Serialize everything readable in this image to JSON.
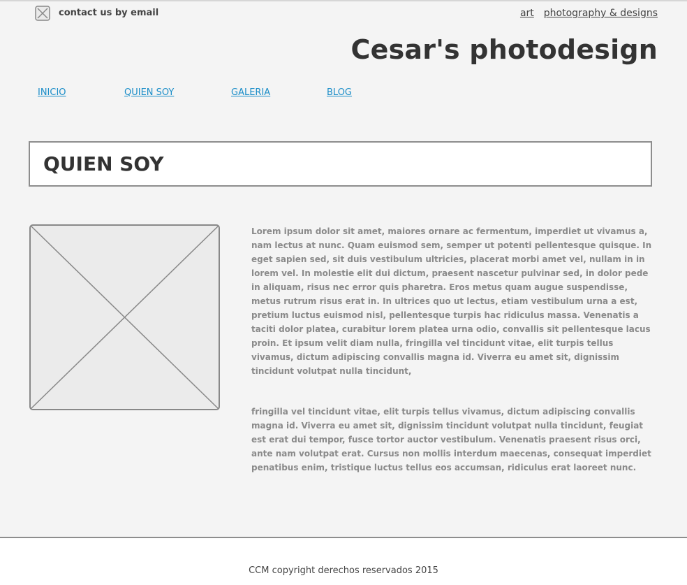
{
  "header": {
    "contact_label": "contact us by email",
    "tagline": [
      "art",
      "photography & designs"
    ],
    "site_title": "Cesar's photodesign"
  },
  "nav": {
    "items": [
      "INICIO",
      "QUIEN SOY",
      "GALERIA",
      "BLOG"
    ]
  },
  "page": {
    "heading": "QUIEN SOY",
    "paragraphs": [
      "Lorem ipsum dolor sit amet, maiores ornare ac fermentum, imperdiet ut vivamus a, nam lectus at nunc. Quam euismod sem, semper ut potenti pellentesque quisque. In eget sapien sed, sit duis vestibulum ultricies, placerat morbi amet vel, nullam in in lorem vel. In molestie elit dui dictum, praesent nascetur pulvinar sed, in dolor pede in aliquam, risus nec error quis pharetra. Eros metus quam augue suspendisse, metus rutrum risus erat in.  In ultrices quo ut lectus, etiam vestibulum urna a est, pretium luctus euismod nisl, pellentesque turpis hac ridiculus massa. Venenatis a taciti dolor platea, curabitur lorem platea urna odio, convallis sit pellentesque lacus proin. Et ipsum velit diam nulla, fringilla vel tincidunt vitae, elit turpis tellus vivamus, dictum adipiscing convallis magna id. Viverra eu amet sit, dignissim tincidunt volutpat nulla tincidunt,",
      " fringilla vel tincidunt vitae, elit turpis tellus vivamus, dictum adipiscing convallis magna id. Viverra eu amet sit, dignissim tincidunt volutpat nulla tincidunt, feugiat est erat dui tempor, fusce tortor auctor vestibulum. Venenatis praesent risus orci, ante nam volutpat erat. Cursus non mollis interdum maecenas, consequat imperdiet penatibus enim, tristique luctus tellus eos accumsan, ridiculus erat laoreet nunc."
    ]
  },
  "footer": {
    "copyright": "CCM copyright derechos reservados 2015"
  },
  "colors": {
    "background": "#f4f4f4",
    "link": "#1a8dc8",
    "text": "#333333",
    "body_text": "#8a8a8a",
    "border": "#8d8d8d"
  },
  "icons": {
    "contact": "envelope-placeholder-icon",
    "image": "image-placeholder-icon"
  }
}
